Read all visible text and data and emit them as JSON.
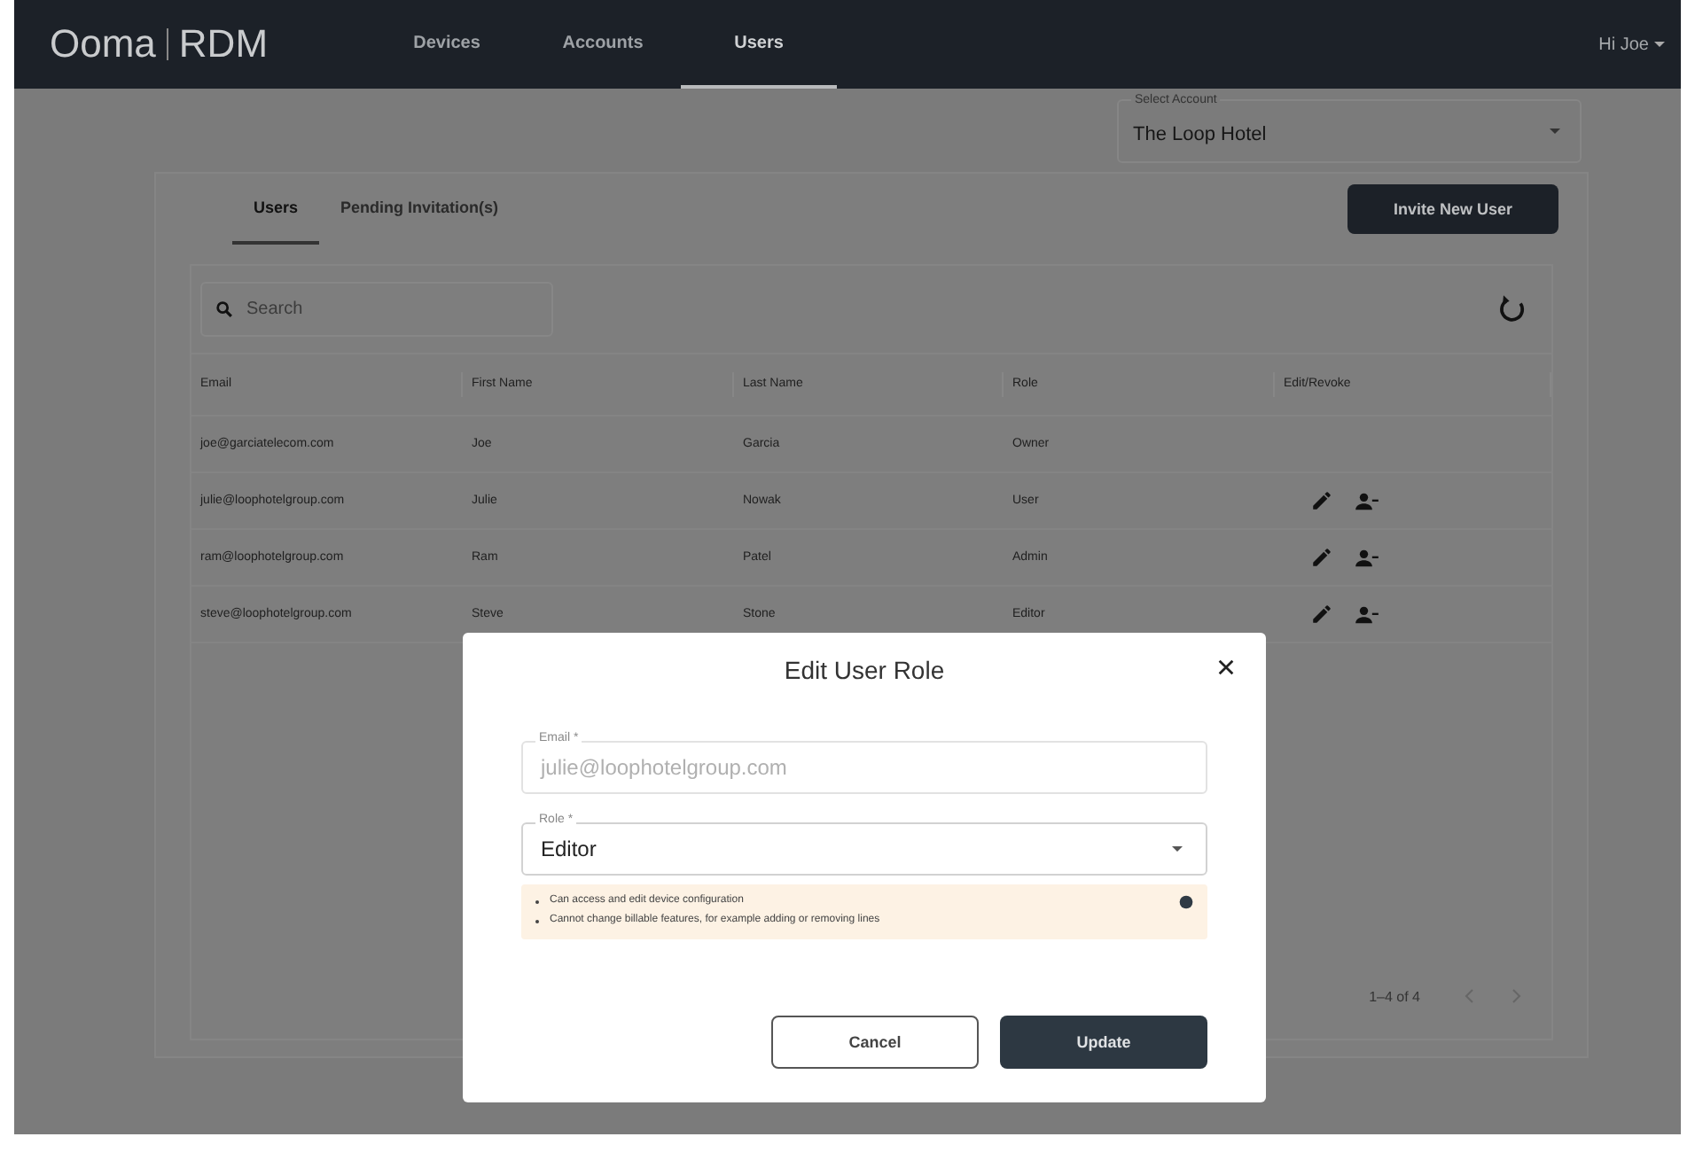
{
  "header": {
    "logo": "Ooma",
    "product": "RDM",
    "nav": [
      {
        "label": "Devices",
        "selected": false
      },
      {
        "label": "Accounts",
        "selected": false
      },
      {
        "label": "Users",
        "selected": true
      }
    ],
    "user_menu": "Hi Joe"
  },
  "account_select": {
    "label": "Select Account",
    "value": "The Loop Hotel"
  },
  "tabs": [
    {
      "label": "Users",
      "selected": true
    },
    {
      "label": "Pending Invitation(s)",
      "selected": false
    }
  ],
  "invite_button": "Invite New User",
  "search": {
    "placeholder": "Search"
  },
  "table": {
    "columns": [
      "Email",
      "First Name",
      "Last Name",
      "Role",
      "Edit/Revoke"
    ],
    "rows": [
      {
        "cells": [
          "joe@garciatelecom.com",
          "Joe",
          "Garcia",
          "Owner"
        ],
        "editable": false
      },
      {
        "cells": [
          "julie@loophotelgroup.com",
          "Julie",
          "Nowak",
          "User"
        ],
        "editable": true
      },
      {
        "cells": [
          "ram@loophotelgroup.com",
          "Ram",
          "Patel",
          "Admin"
        ],
        "editable": true
      },
      {
        "cells": [
          "steve@loophotelgroup.com",
          "Steve",
          "Stone",
          "Editor"
        ],
        "editable": true
      }
    ]
  },
  "pagination": {
    "range": "1–4 of 4"
  },
  "dialog": {
    "title": "Edit User Role",
    "fields": [
      {
        "kind": "text",
        "label": "Email *",
        "value": "julie@loophotelgroup.com",
        "disabled": true
      },
      {
        "kind": "select",
        "label": "Role *",
        "value": "Editor",
        "disabled": false
      }
    ],
    "notes": [
      "Can access and edit device configuration",
      "Cannot change billable features, for example adding or removing lines"
    ],
    "buttons": [
      {
        "label": "Cancel",
        "kind": "secondary"
      },
      {
        "label": "Update",
        "kind": "primary"
      }
    ]
  }
}
